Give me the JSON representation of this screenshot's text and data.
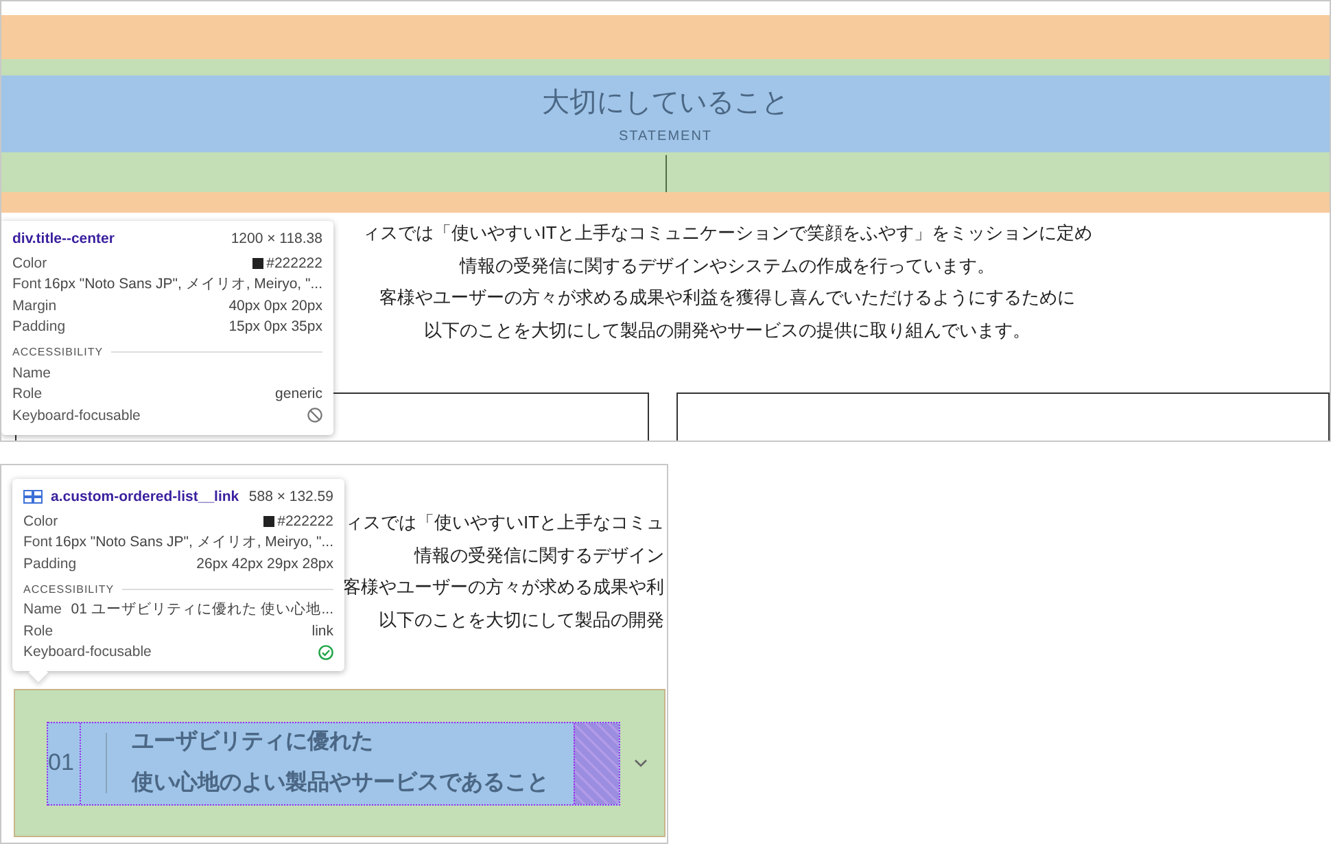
{
  "top_view": {
    "heading": "大切にしていること",
    "subheading": "STATEMENT",
    "intro_lines": [
      "ィスでは「使いやすいITと上手なコミュニケーションで笑顔をふやす」をミッションに定め",
      "情報の受発信に関するデザインやシステムの作成を行っています。",
      "客様やユーザーの方々が求める成果や利益を獲得し喜んでいただけるようにするために",
      "以下のことを大切にして製品の開発やサービスの提供に取り組んでいます。"
    ],
    "tooltip": {
      "selector": "div.title--center",
      "size": "1200 × 118.38",
      "properties": [
        {
          "label": "Color",
          "value": "#222222",
          "kind": "color"
        },
        {
          "label": "Font",
          "value": "16px \"Noto Sans JP\", メイリオ, Meiryo, \"...",
          "kind": "text"
        },
        {
          "label": "Margin",
          "value": "40px 0px 20px",
          "kind": "text"
        },
        {
          "label": "Padding",
          "value": "15px 0px 35px",
          "kind": "text"
        }
      ],
      "section": "ACCESSIBILITY",
      "accessibility": [
        {
          "label": "Name"
        },
        {
          "label": "Role",
          "value": "generic"
        },
        {
          "label": "Keyboard-focusable",
          "focusable": false
        }
      ]
    }
  },
  "bottom_view": {
    "intro_lines": [
      "ィスでは「使いやすいITと上手なコミュ",
      "情報の受発信に関するデザイン",
      "客様やユーザーの方々が求める成果や利",
      "以下のことを大切にして製品の開発"
    ],
    "tooltip": {
      "selector": "a.custom-ordered-list__link",
      "size": "588 × 132.59",
      "properties": [
        {
          "label": "Color",
          "value": "#222222",
          "kind": "color"
        },
        {
          "label": "Font",
          "value": "16px \"Noto Sans JP\", メイリオ, Meiryo, \"...",
          "kind": "text"
        },
        {
          "label": "Padding",
          "value": "26px 42px 29px 28px",
          "kind": "text"
        }
      ],
      "section": "ACCESSIBILITY",
      "accessibility": [
        {
          "label": "Name",
          "value": "01 ユーザビリティに優れた 使い心地..."
        },
        {
          "label": "Role",
          "value": "link"
        },
        {
          "label": "Keyboard-focusable",
          "focusable": true
        }
      ]
    },
    "list_item": {
      "number": "01",
      "lines": [
        "ユーザビリティに優れた",
        "使い心地のよい製品やサービスであること"
      ]
    }
  }
}
